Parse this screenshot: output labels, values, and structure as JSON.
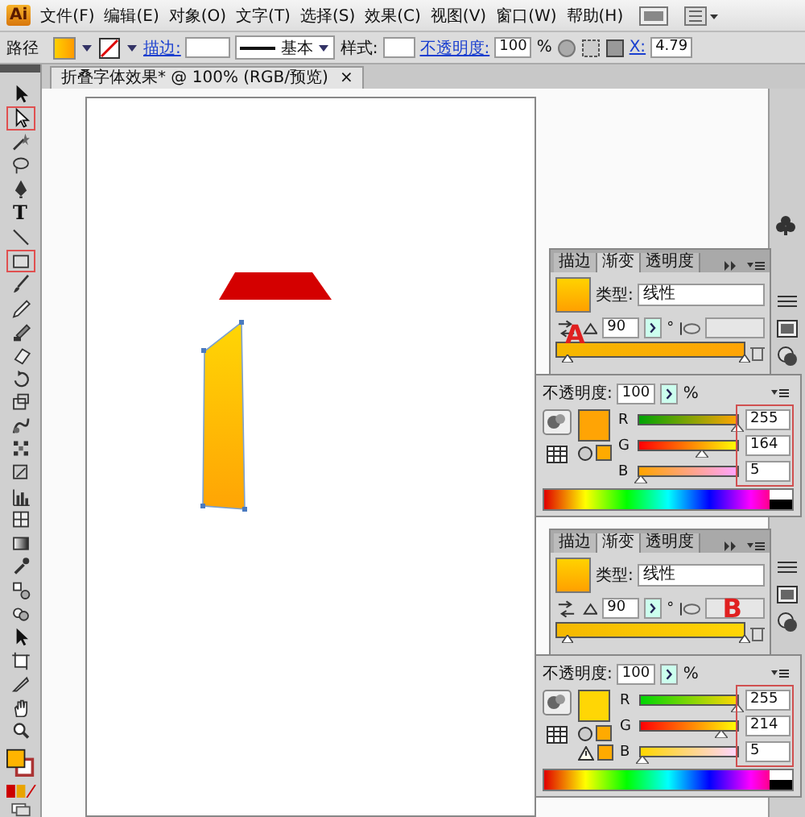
{
  "app": {
    "logo": "Ai"
  },
  "menu": [
    "文件(F)",
    "编辑(E)",
    "对象(O)",
    "文字(T)",
    "选择(S)",
    "效果(C)",
    "视图(V)",
    "窗口(W)",
    "帮助(H)"
  ],
  "control_bar": {
    "label": "路径",
    "stroke_label": "描边:",
    "stroke_profile": "基本",
    "style_label": "样式:",
    "opacity_label": "不透明度:",
    "opacity": "100",
    "percent": "%",
    "x_label": "X:",
    "x_value": "4.79"
  },
  "document_tab": {
    "title": "折叠字体效果* @ 100% (RGB/预览)",
    "close": "×"
  },
  "tools": [
    {
      "kind": "select",
      "highlighted": false
    },
    {
      "kind": "direct",
      "highlighted": true
    },
    {
      "kind": "wand",
      "highlighted": false
    },
    {
      "kind": "lasso",
      "highlighted": false
    },
    {
      "kind": "pen",
      "highlighted": false
    },
    {
      "kind": "type",
      "glyph": "T",
      "highlighted": false
    },
    {
      "kind": "line",
      "highlighted": false
    },
    {
      "kind": "rect",
      "highlighted": true
    },
    {
      "kind": "brush",
      "highlighted": false
    },
    {
      "kind": "pencil",
      "highlighted": false
    },
    {
      "kind": "blob",
      "highlighted": false
    },
    {
      "kind": "eraser",
      "highlighted": false
    },
    {
      "kind": "rotate",
      "highlighted": false
    },
    {
      "kind": "scale",
      "highlighted": false
    },
    {
      "kind": "warp",
      "highlighted": false
    },
    {
      "kind": "grid",
      "highlighted": false
    },
    {
      "kind": "symbol",
      "highlighted": false
    },
    {
      "kind": "graph",
      "highlighted": false
    },
    {
      "kind": "mesh",
      "highlighted": false
    },
    {
      "kind": "gradient",
      "highlighted": false
    },
    {
      "kind": "eyedropper",
      "highlighted": false
    },
    {
      "kind": "blend",
      "highlighted": false
    },
    {
      "kind": "livepaint",
      "highlighted": false
    },
    {
      "kind": "select",
      "highlighted": false
    },
    {
      "kind": "artboard",
      "highlighted": false
    },
    {
      "kind": "slice",
      "highlighted": false
    },
    {
      "kind": "hand",
      "highlighted": false
    },
    {
      "kind": "zoom",
      "highlighted": false
    }
  ],
  "panels": [
    {
      "marker": "A",
      "tabs": [
        {
          "label": "描边",
          "selected": false
        },
        {
          "label": "渐变",
          "selected": true
        },
        {
          "label": "透明度",
          "selected": false
        }
      ],
      "type_label": "类型:",
      "type": "线性",
      "angle": "90",
      "degree": "°",
      "color": "#ffa405",
      "opacity_label": "不透明度:",
      "opacity": "100",
      "percent": "%",
      "gamut_warning": false,
      "values_boxed": true,
      "channels": [
        {
          "name": "R",
          "value": "255",
          "level": 1
        },
        {
          "name": "G",
          "value": "164",
          "level": 0.64
        },
        {
          "name": "B",
          "value": "5",
          "level": 0.02
        }
      ]
    },
    {
      "marker": "B",
      "tabs": [
        {
          "label": "描边",
          "selected": false
        },
        {
          "label": "渐变",
          "selected": true
        },
        {
          "label": "透明度",
          "selected": false
        }
      ],
      "type_label": "类型:",
      "type": "线性",
      "angle": "90",
      "degree": "°",
      "color": "#ffd605",
      "opacity_label": "不透明度:",
      "opacity": "100",
      "percent": "%",
      "gamut_warning": true,
      "values_boxed": true,
      "channels": [
        {
          "name": "R",
          "value": "255",
          "level": 1
        },
        {
          "name": "G",
          "value": "214",
          "level": 0.84
        },
        {
          "name": "B",
          "value": "5",
          "level": 0.02
        }
      ]
    }
  ]
}
